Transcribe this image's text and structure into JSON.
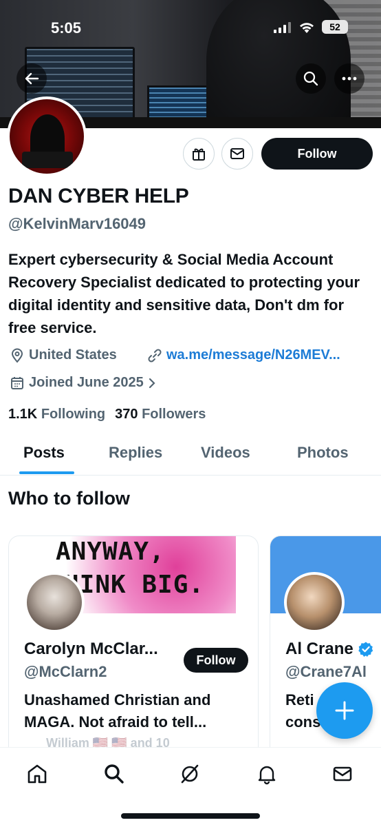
{
  "status_bar": {
    "time": "5:05",
    "battery": "52"
  },
  "profile": {
    "name": "DAN CYBER HELP",
    "handle": "@KelvinMarv16049",
    "bio": "Expert cybersecurity & Social Media Account Recovery Specialist dedicated to protecting your digital identity and sensitive data, Don't dm for free service.",
    "location": "United States",
    "link": "wa.me/message/N26MEV...",
    "joined": "Joined June 2025",
    "following_count": "1.1K",
    "following_label": "Following",
    "followers_count": "370",
    "followers_label": "Followers",
    "follow_label": "Follow"
  },
  "tabs": [
    {
      "label": "Posts",
      "active": true
    },
    {
      "label": "Replies",
      "active": false
    },
    {
      "label": "Videos",
      "active": false
    },
    {
      "label": "Photos",
      "active": false
    }
  ],
  "who_to_follow": {
    "title": "Who to follow",
    "cards": [
      {
        "cover_line1": "ANYWAY,",
        "cover_line2": "HINK BIG.",
        "name": "Carolyn McClar...",
        "handle": "@McClarn2",
        "bio": "Unashamed Christian and MAGA. Not afraid to tell...",
        "follow_label": "Follow",
        "followed_by": "William 🇺🇸 🇺🇸 and 10"
      },
      {
        "name": "Al Crane",
        "verified": true,
        "handle": "@Crane7Al",
        "bio_line1": "Reti",
        "bio_line2": "cons"
      }
    ]
  },
  "colors": {
    "accent": "#1d9bf0",
    "link": "#1d7cd6",
    "text": "#0f1419",
    "muted": "#536471"
  },
  "icons": {
    "back": "arrow-left-icon",
    "search": "search-icon",
    "more": "more-icon",
    "gift": "gift-icon",
    "message": "mail-icon",
    "location": "location-pin-icon",
    "link": "link-icon",
    "calendar": "calendar-icon",
    "compose": "plus-icon",
    "nav": [
      "home-icon",
      "search-icon",
      "grok-icon",
      "bell-icon",
      "mail-icon"
    ]
  }
}
